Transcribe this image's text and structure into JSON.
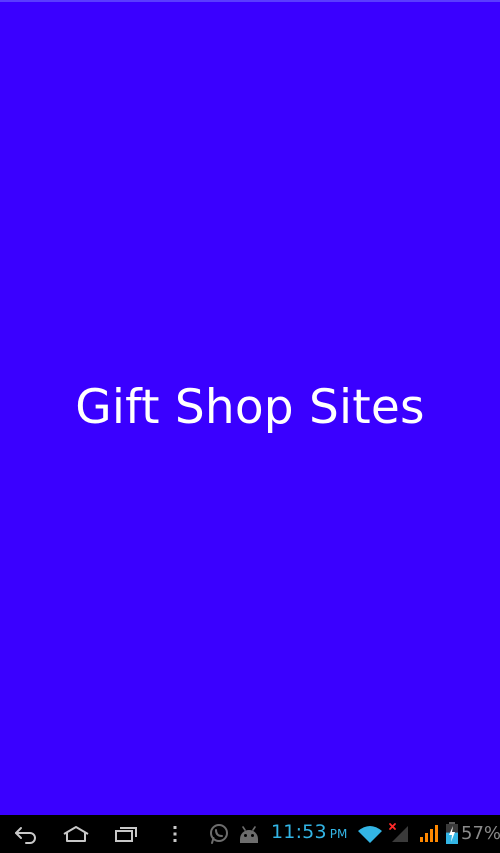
{
  "app": {
    "title": "Gift Shop Sites"
  },
  "colors": {
    "background": "#3a00ff",
    "top_line": "#5a3cff",
    "title_text": "#ffffff",
    "nav_icons": "#c8c8c8",
    "status_icons_dim": "#6d6d6d",
    "clock_text": "#33b5e5",
    "signal_orange": "#ff8800",
    "signal_missing": "#ff2a2a",
    "battery_text": "#8a8a8a"
  },
  "navbar": {
    "back": "back-icon",
    "home": "home-icon",
    "recents": "recent-apps-icon",
    "menu": "overflow-menu-icon"
  },
  "status": {
    "time": "11:53",
    "ampm": "PM",
    "battery_percent": "57%",
    "battery_level": 0.57,
    "icons": [
      "whatsapp-icon",
      "android-icon",
      "wifi-icon",
      "no-signal-icon",
      "signal-icon",
      "battery-charging-icon"
    ]
  }
}
